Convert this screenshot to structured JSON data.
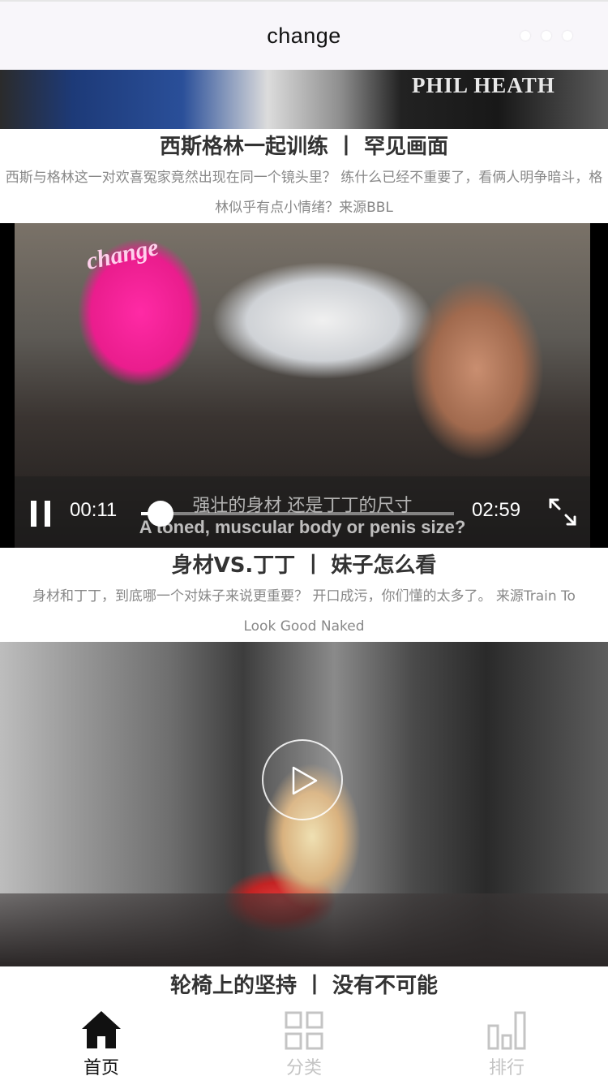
{
  "header": {
    "title": "change"
  },
  "feed": {
    "items": [
      {
        "title": "西斯格林一起训练 丨 罕见画面",
        "description": "西斯与格林这一对欢喜冤家竟然出现在同一个镜头里？ 练什么已经不重要了，看俩人明争暗斗，格林似乎有点小情绪？来源BBL",
        "thumbnail_print": "PHIL HEATH"
      },
      {
        "title": "身材VS.丁丁 丨 妹子怎么看",
        "description": "身材和丁丁，到底哪一个对妹子来说更重要？ 开口成污，你们懂的太多了。 来源Train To Look Good Naked",
        "thumbnail_print": "change",
        "player": {
          "current_time": "00:11",
          "total_time": "02:59",
          "progress_fraction": 0.061,
          "subtitle_cn": "强壮的身材 还是丁丁的尺寸",
          "subtitle_en": "A toned, muscular body or penis size?",
          "state": "playing"
        }
      },
      {
        "title": "轮椅上的坚持 丨 没有不可能",
        "player": {
          "state": "paused"
        }
      }
    ]
  },
  "tabbar": {
    "tabs": [
      {
        "label": "首页",
        "icon": "home-icon",
        "active": true
      },
      {
        "label": "分类",
        "icon": "grid-icon",
        "active": false
      },
      {
        "label": "排行",
        "icon": "bar-chart-icon",
        "active": false
      }
    ]
  },
  "colors": {
    "header_bg": "#f8f6fa",
    "title_text": "#333333",
    "desc_text": "#888888",
    "tab_active": "#111111",
    "tab_inactive": "#c4c4c4"
  }
}
